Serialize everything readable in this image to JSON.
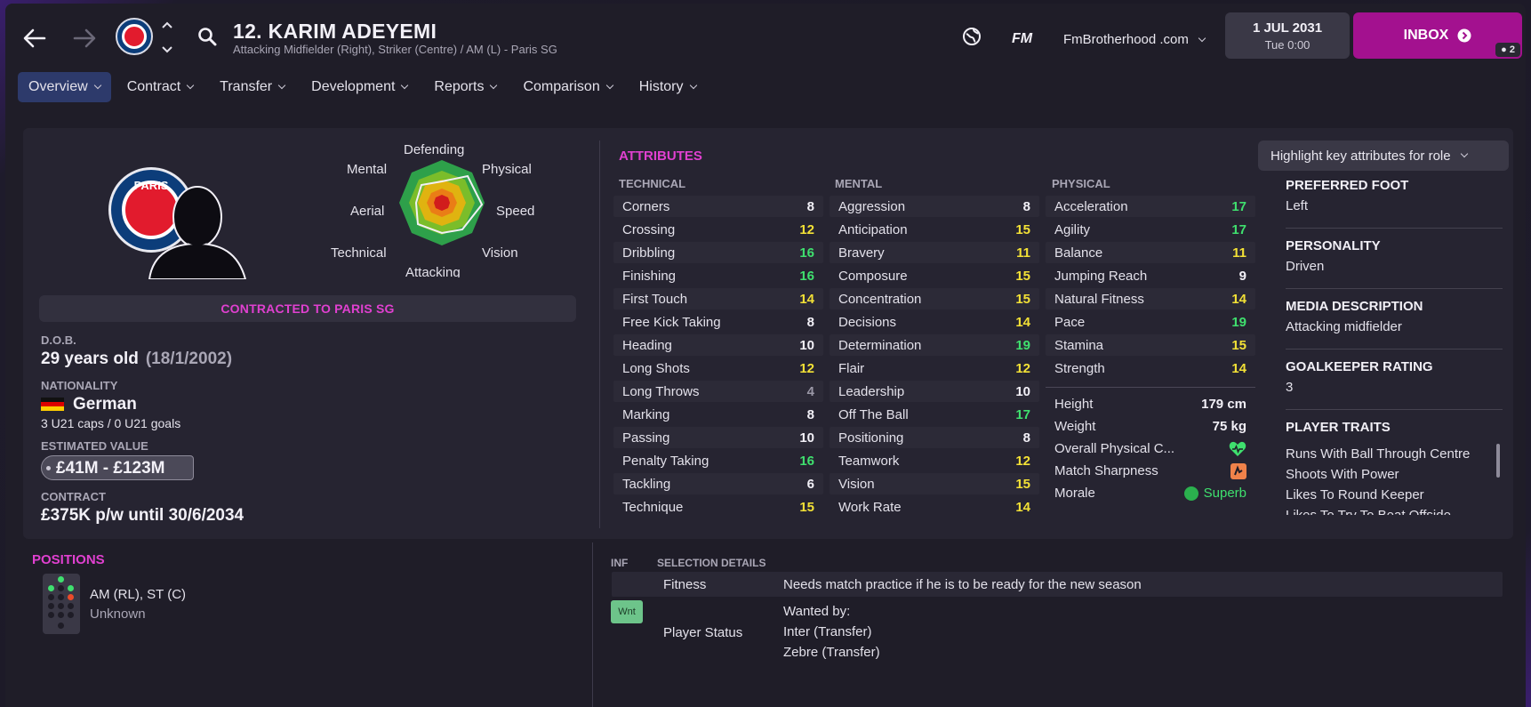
{
  "header": {
    "title": "12. KARIM ADEYEMI",
    "subtitle": "Attacking Midfielder (Right), Striker (Centre) / AM (L) - Paris SG",
    "fm_logo": "FM",
    "site": "FmBrotherhood .com",
    "date": "1 JUL 2031",
    "time": "Tue 0:00",
    "inbox_label": "INBOX",
    "inbox_count": "2",
    "badge_text": "PARIS"
  },
  "tabs": [
    {
      "label": "Overview"
    },
    {
      "label": "Contract"
    },
    {
      "label": "Transfer"
    },
    {
      "label": "Development"
    },
    {
      "label": "Reports"
    },
    {
      "label": "Comparison"
    },
    {
      "label": "History"
    }
  ],
  "radar": {
    "labels": {
      "defending": "Defending",
      "physical": "Physical",
      "speed": "Speed",
      "vision": "Vision",
      "attacking": "Attacking",
      "technical": "Technical",
      "aerial": "Aerial",
      "mental": "Mental"
    }
  },
  "profile": {
    "contracted": "CONTRACTED TO PARIS SG",
    "dob_label": "D.O.B.",
    "age": "29 years old",
    "dob": "(18/1/2002)",
    "nationality_label": "NATIONALITY",
    "nationality": "German",
    "caps": "3 U21 caps / 0 U21 goals",
    "value_label": "ESTIMATED VALUE",
    "value": "£41M - £123M",
    "contract_label": "CONTRACT",
    "contract": "£375K p/w until 30/6/2034"
  },
  "attributes": {
    "title": "ATTRIBUTES",
    "highlight_btn": "Highlight key attributes for role",
    "technical_head": "TECHNICAL",
    "mental_head": "MENTAL",
    "physical_head": "PHYSICAL",
    "technical": [
      {
        "name": "Corners",
        "value": "8"
      },
      {
        "name": "Crossing",
        "value": "12"
      },
      {
        "name": "Dribbling",
        "value": "16"
      },
      {
        "name": "Finishing",
        "value": "16"
      },
      {
        "name": "First Touch",
        "value": "14"
      },
      {
        "name": "Free Kick Taking",
        "value": "8"
      },
      {
        "name": "Heading",
        "value": "10"
      },
      {
        "name": "Long Shots",
        "value": "12"
      },
      {
        "name": "Long Throws",
        "value": "4"
      },
      {
        "name": "Marking",
        "value": "8"
      },
      {
        "name": "Passing",
        "value": "10"
      },
      {
        "name": "Penalty Taking",
        "value": "16"
      },
      {
        "name": "Tackling",
        "value": "6"
      },
      {
        "name": "Technique",
        "value": "15"
      }
    ],
    "mental": [
      {
        "name": "Aggression",
        "value": "8"
      },
      {
        "name": "Anticipation",
        "value": "15"
      },
      {
        "name": "Bravery",
        "value": "11"
      },
      {
        "name": "Composure",
        "value": "15"
      },
      {
        "name": "Concentration",
        "value": "15"
      },
      {
        "name": "Decisions",
        "value": "14"
      },
      {
        "name": "Determination",
        "value": "19"
      },
      {
        "name": "Flair",
        "value": "12"
      },
      {
        "name": "Leadership",
        "value": "10"
      },
      {
        "name": "Off The Ball",
        "value": "17"
      },
      {
        "name": "Positioning",
        "value": "8"
      },
      {
        "name": "Teamwork",
        "value": "12"
      },
      {
        "name": "Vision",
        "value": "15"
      },
      {
        "name": "Work Rate",
        "value": "14"
      }
    ],
    "physical": [
      {
        "name": "Acceleration",
        "value": "17"
      },
      {
        "name": "Agility",
        "value": "17"
      },
      {
        "name": "Balance",
        "value": "11"
      },
      {
        "name": "Jumping Reach",
        "value": "9"
      },
      {
        "name": "Natural Fitness",
        "value": "14"
      },
      {
        "name": "Pace",
        "value": "19"
      },
      {
        "name": "Stamina",
        "value": "15"
      },
      {
        "name": "Strength",
        "value": "14"
      }
    ],
    "height_label": "Height",
    "height": "179 cm",
    "weight_label": "Weight",
    "weight": "75 kg",
    "condition_label": "Overall Physical C...",
    "sharpness_label": "Match Sharpness",
    "morale_label": "Morale",
    "morale": "Superb"
  },
  "info": {
    "foot_label": "PREFERRED FOOT",
    "foot": "Left",
    "personality_label": "PERSONALITY",
    "personality": "Driven",
    "media_label": "MEDIA DESCRIPTION",
    "media": "Attacking midfielder",
    "gk_label": "GOALKEEPER RATING",
    "gk": "3",
    "traits_label": "PLAYER TRAITS",
    "traits": [
      "Runs With Ball Through Centre",
      "Shoots With Power",
      "Likes To Round Keeper",
      "Likes To Try To Beat Offside"
    ]
  },
  "positions": {
    "title": "POSITIONS",
    "text": "AM (RL), ST (C)",
    "sub": "Unknown"
  },
  "selection": {
    "inf_head": "INF",
    "details_head": "SELECTION DETAILS",
    "fitness_label": "Fitness",
    "fitness": "Needs match practice if he is to be ready for the new season",
    "badge": "Wnt",
    "status_label": "Player Status",
    "wanted_by": "Wanted by:",
    "club1": "Inter (Transfer)",
    "club2": "Zebre (Transfer)"
  },
  "colors": {
    "accent_pink": "#e040d0",
    "inbox": "#a3118f",
    "attr_white": "#f2f0f7",
    "attr_yellow": "#f3e136",
    "attr_green": "#3fe06e"
  }
}
